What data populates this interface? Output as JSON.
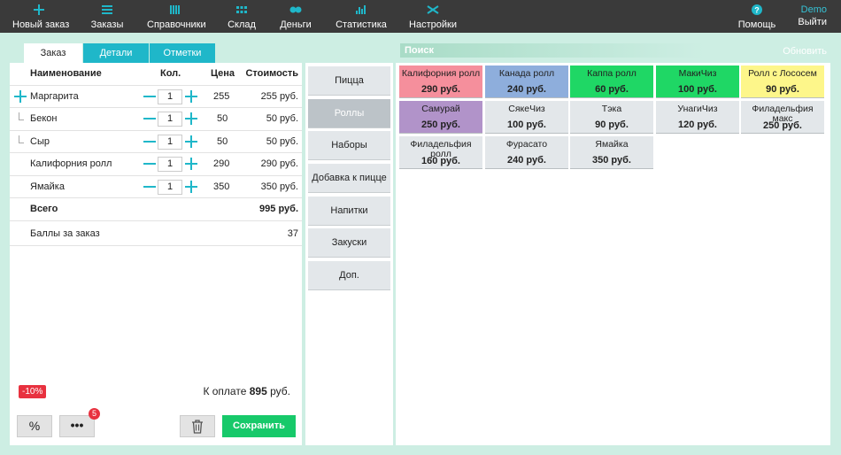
{
  "colors": {
    "topbar": "#3a3a3a",
    "accent": "#1fb7c9",
    "save": "#17c96a",
    "badge": "#e8313f",
    "background": "#cdeee3"
  },
  "nav": [
    {
      "label": "Новый заказ",
      "icon": "plus-icon"
    },
    {
      "label": "Заказы",
      "icon": "list-icon"
    },
    {
      "label": "Справочники",
      "icon": "book-icon"
    },
    {
      "label": "Склад",
      "icon": "grid-icon"
    },
    {
      "label": "Деньги",
      "icon": "coins-icon"
    },
    {
      "label": "Статистика",
      "icon": "chart-icon"
    },
    {
      "label": "Настройки",
      "icon": "wrench-icon"
    }
  ],
  "help": {
    "label": "Помощь",
    "icon": "help-icon"
  },
  "user": {
    "name": "Demo",
    "logout": "Выйти"
  },
  "tabs": [
    "Заказ",
    "Детали",
    "Отметки"
  ],
  "order": {
    "headers": {
      "name": "Наименование",
      "qty": "Кол.",
      "price": "Цена",
      "cost": "Стоимость"
    },
    "items": [
      {
        "name": "Маргарита",
        "qty": "1",
        "price": "255",
        "cost": "255 руб."
      },
      {
        "name": "Бекон",
        "qty": "1",
        "price": "50",
        "cost": "50 руб."
      },
      {
        "name": "Сыр",
        "qty": "1",
        "price": "50",
        "cost": "50 руб."
      },
      {
        "name": "Калифорния ролл",
        "qty": "1",
        "price": "290",
        "cost": "290 руб."
      },
      {
        "name": "Ямайка",
        "qty": "1",
        "price": "350",
        "cost": "350 руб."
      }
    ],
    "total_label": "Всего",
    "total_value": "995 руб.",
    "points_label": "Баллы за заказ",
    "points_value": "37",
    "discount_badge": "-10%",
    "pay_label": "К оплате",
    "pay_amount": "895",
    "pay_currency": "руб.",
    "percent_button": "%",
    "more_button": "•••",
    "more_badge": "5",
    "save_button": "Сохранить"
  },
  "categories": [
    {
      "label": "Пицца",
      "active": false
    },
    {
      "label": "Роллы",
      "active": true
    },
    {
      "label": "Наборы",
      "active": false
    },
    {
      "label": "Добавка к пицце",
      "active": false
    },
    {
      "label": "Напитки",
      "active": false
    },
    {
      "label": "Закуски",
      "active": false
    },
    {
      "label": "Доп.",
      "active": false
    }
  ],
  "search": {
    "placeholder": "Поиск",
    "refresh": "Обновить"
  },
  "products": [
    {
      "name": "Калифорния ролл",
      "price": "290 руб.",
      "color": "#f58f9c"
    },
    {
      "name": "Канада ролл",
      "price": "240 руб.",
      "color": "#8eaedc"
    },
    {
      "name": "Каппа ролл",
      "price": "60 руб.",
      "color": "#1fd765"
    },
    {
      "name": "МакиЧиз",
      "price": "100 руб.",
      "color": "#1fd765"
    },
    {
      "name": "Ролл с Лососем",
      "price": "90 руб.",
      "color": "#fdf68a"
    },
    {
      "name": "Самурай",
      "price": "250 руб.",
      "color": "#b193c9"
    },
    {
      "name": "СякеЧиз",
      "price": "100 руб.",
      "color": "#e3e7ea"
    },
    {
      "name": "Тэка",
      "price": "90 руб.",
      "color": "#e3e7ea"
    },
    {
      "name": "УнагиЧиз",
      "price": "120 руб.",
      "color": "#e3e7ea"
    },
    {
      "name": "Филадельфия макс",
      "price": "250 руб.",
      "color": "#e3e7ea"
    },
    {
      "name": "Филадельфия ролл",
      "price": "160 руб.",
      "color": "#e3e7ea"
    },
    {
      "name": "Фурасато",
      "price": "240 руб.",
      "color": "#e3e7ea"
    },
    {
      "name": "Ямайка",
      "price": "350 руб.",
      "color": "#e3e7ea"
    }
  ]
}
